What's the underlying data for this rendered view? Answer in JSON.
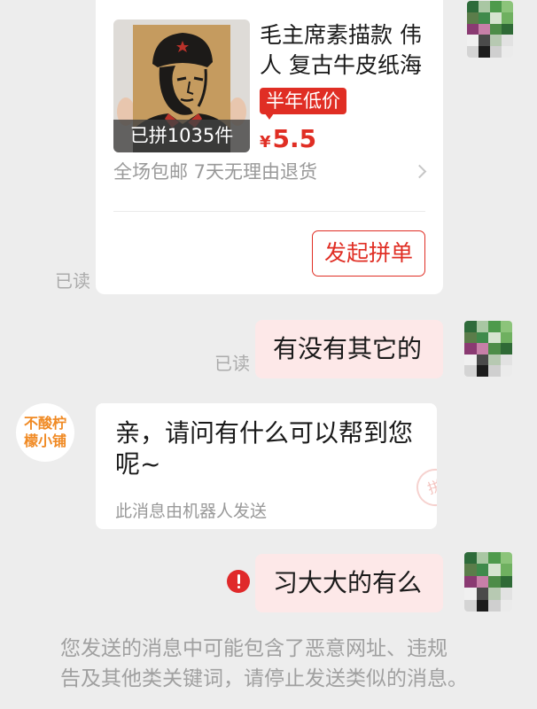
{
  "colors": {
    "background": "#ededed",
    "accent_red": "#e02e24",
    "outgoing_bubble": "#fde8e8",
    "incoming_bubble": "#ffffff",
    "muted_text": "#a3a3a3",
    "shop_logo_text": "#f08a24"
  },
  "product_card": {
    "image_icon": "mao-sketch-kraft-poster-image",
    "sold_count": "已拼1035件",
    "title_lines": [
      "毛主席素描款 伟",
      "人 复古牛皮纸海"
    ],
    "badge": "半年低价",
    "price_symbol": "¥",
    "price": "5.5",
    "services": "全场包邮 7天无理由退货",
    "services_icon": "chevron-right-icon",
    "action_button": "发起拼单"
  },
  "product_card_read_status": "已读",
  "outgoing_message_1": {
    "text": "有没有其它的",
    "read_status": "已读"
  },
  "shop_reply": {
    "shop_avatar_lines": [
      "不酸柠",
      "檬小铺"
    ],
    "text_lines": [
      "亲，请问有什么可以帮到您",
      "呢~"
    ],
    "footer": "此消息由机器人发送",
    "watermark": "拼"
  },
  "outgoing_message_2": {
    "text": "习大大的有么",
    "status_icon": "error-icon"
  },
  "system_notice": {
    "lines": [
      "您发送的消息中可能包含了恶意网址、违规",
      "告及其他类关键词，请停止发送类似的消息。"
    ]
  },
  "user_avatar": {
    "icon": "pixelated-avatar",
    "mosaic": [
      "#2e6b3a",
      "#a9c7a3",
      "#4e9a4c",
      "#8cc47a",
      "#5b7d4a",
      "#3f8a4b",
      "#d6e4d0",
      "#6fb060",
      "#8a3a72",
      "#c77fa8",
      "#4d8c48",
      "#2f6a36",
      "#f0f0f0",
      "#4a4a4a",
      "#b7c9b2",
      "#e2e2e2",
      "#d4d4d4",
      "#1c1c1c",
      "#cfcfcf",
      "#ebebeb"
    ]
  }
}
